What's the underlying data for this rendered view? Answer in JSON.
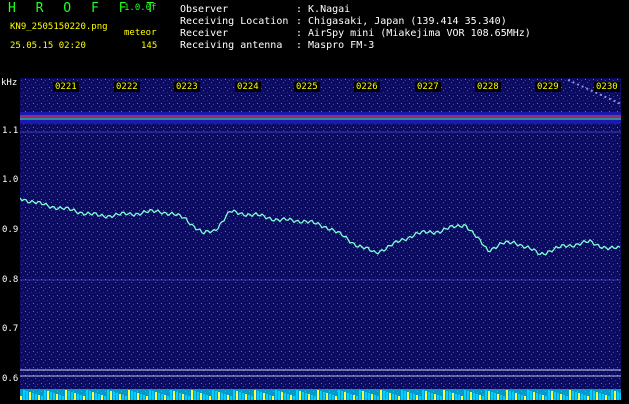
{
  "app": {
    "title": "H R O F F T",
    "version": "1.0.0f",
    "filename": "KN9_2505150220.png",
    "mode": "meteor",
    "datetime": "25.05.15 02:20",
    "count": "145"
  },
  "info": {
    "observer_label": "Observer",
    "observer_value": ": K.Nagai",
    "location_label": "Receiving Location",
    "location_value": ": Chigasaki, Japan (139.414 35.340)",
    "receiver_label": "Receiver",
    "receiver_value": ": AirSpy mini (Miakejima VOR 108.65MHz)",
    "antenna_label": "Receiving antenna",
    "antenna_value": ": Maspro FM-3"
  },
  "plot": {
    "y_unit": "kHz",
    "y_ticks": [
      "1.1",
      "1.0",
      "0.9",
      "0.8",
      "0.7",
      "0.6"
    ],
    "x_ticks": [
      "0221",
      "0222",
      "0223",
      "0224",
      "0225",
      "0226",
      "0227",
      "0228",
      "0229",
      "0230"
    ]
  },
  "colors": {
    "background": "#0a0a5a",
    "trace": "#7fffd4",
    "band": "#ff4040",
    "header_yellow": "#ffff00",
    "header_green": "#22ff22"
  }
}
